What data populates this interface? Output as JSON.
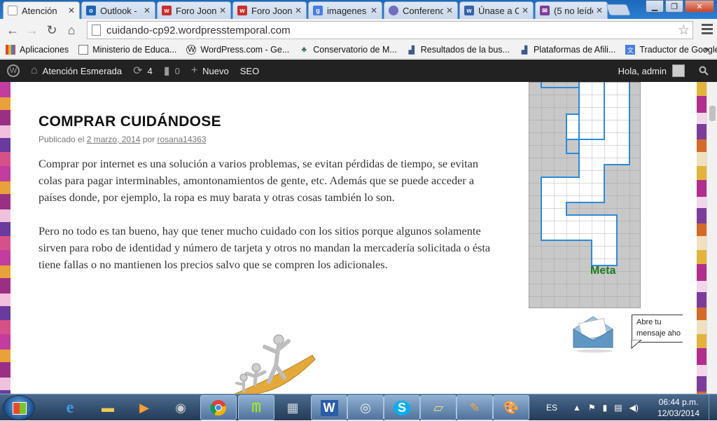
{
  "browser": {
    "tabs": [
      {
        "label": "Atención",
        "favicon": "wordpress-page-icon",
        "color": "#f2f2f2",
        "active": true
      },
      {
        "label": "Outlook -",
        "favicon": "outlook-icon",
        "color": "#1f63b5"
      },
      {
        "label": "Foro Joon",
        "favicon": "joomla-icon",
        "color": "#c9302c"
      },
      {
        "label": "Foro Joon",
        "favicon": "joomla-icon",
        "color": "#c9302c"
      },
      {
        "label": "imagenes",
        "favicon": "google-icon",
        "color": "#4a7de0"
      },
      {
        "label": "Conferenc",
        "favicon": "conference-icon",
        "color": "#6f6fbf"
      },
      {
        "label": "Únase a C",
        "favicon": "union-icon",
        "color": "#3563a8"
      },
      {
        "label": "(5 no leído",
        "favicon": "mail-icon",
        "color": "#7d3e99"
      }
    ],
    "url": "cuidando-cp92.wordpresstemporal.com",
    "bookmarks": [
      {
        "label": "Aplicaciones",
        "icon": "apps-grid-icon"
      },
      {
        "label": "Ministerio de Educa...",
        "icon": "page-icon"
      },
      {
        "label": "WordPress.com - Ge...",
        "icon": "wordpress-icon"
      },
      {
        "label": "Conservatorio de M...",
        "icon": "conservatory-icon"
      },
      {
        "label": "Resultados de la bus...",
        "icon": "chart-icon"
      },
      {
        "label": "Plataformas de Afili...",
        "icon": "chart-icon"
      },
      {
        "label": "Traductor de Google",
        "icon": "translate-icon"
      }
    ],
    "bookmarks_more": "»"
  },
  "adminbar": {
    "site_name": "Atención Esmerada",
    "updates_count": "4",
    "comments_count": "0",
    "new_label": "Nuevo",
    "seo_label": "SEO",
    "greeting": "Hola, admin"
  },
  "post": {
    "title": "COMPRAR CUIDÁNDOSE",
    "published_prefix": "Publicado el",
    "date": "2 marzo, 2014",
    "by": "por",
    "author": "rosana14363",
    "paragraphs": [
      "Comprar por internet es una solución a varios problemas, se evitan pérdidas de tiempo, se evitan colas para pagar interminables, amontonamientos de gente, etc. Además que se puede acceder a países donde, por ejemplo, la ropa es muy barata y otras cosas también lo son.",
      "Pero no todo es tan bueno, hay que tener mucho cuidado con los sitios porque algunos solamente sirven para robo de identidad y número de tarjeta y otros no mandan la mercadería solicitada o ésta tiene fallas o no mantienen los precios salvo que se compren los adicionales."
    ]
  },
  "sidebar": {
    "maze_label": "Meta",
    "message_bubble": [
      "Abre tu",
      "mensaje aho"
    ]
  },
  "taskbar": {
    "apps": [
      "ie-icon",
      "explorer-icon",
      "media-player-icon",
      "webcam-icon",
      "chrome-icon",
      "movistar-icon",
      "calculator-icon",
      "word-icon",
      "app-icon",
      "skype-icon",
      "notes-icon",
      "pen-app-icon",
      "paint-icon"
    ],
    "language": "ES",
    "time": "06:44 p.m.",
    "date": "12/03/2014"
  }
}
